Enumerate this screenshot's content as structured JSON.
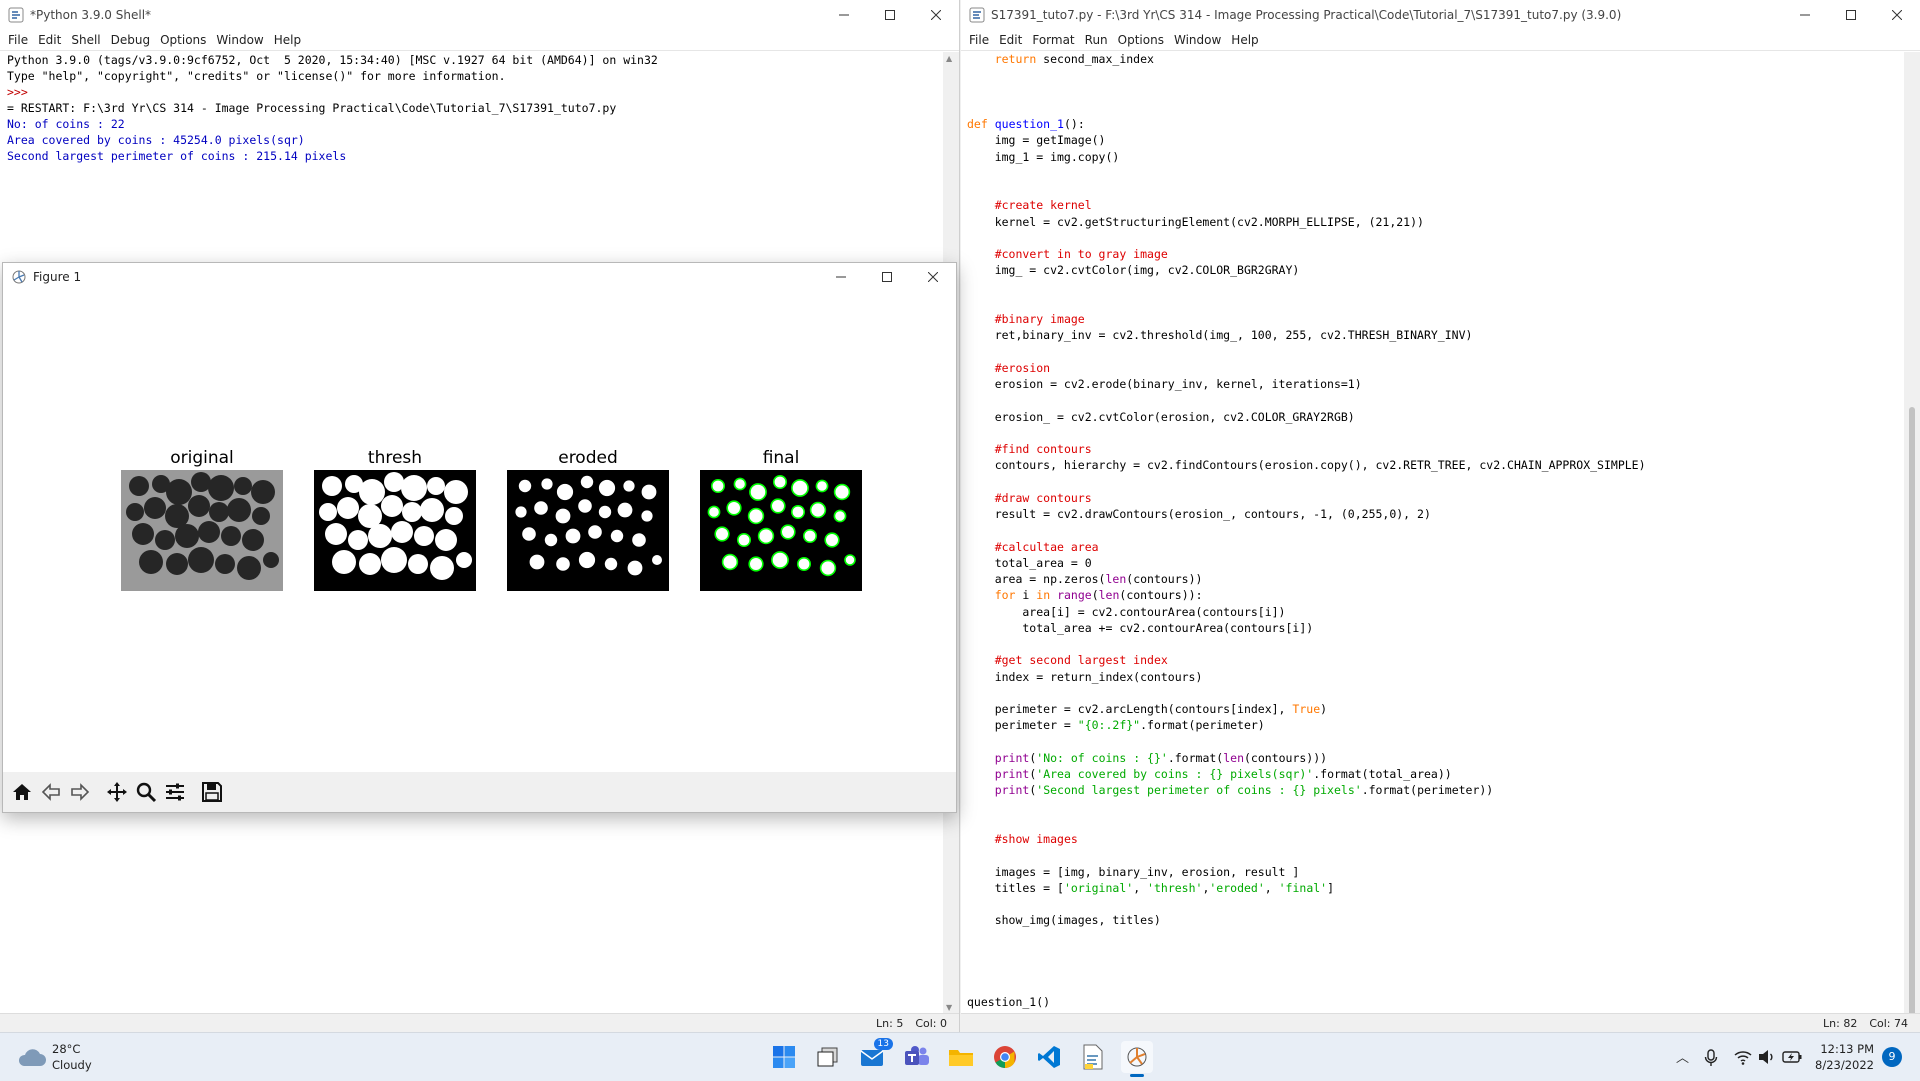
{
  "shell": {
    "title": "*Python 3.9.0 Shell*",
    "menu": [
      "File",
      "Edit",
      "Shell",
      "Debug",
      "Options",
      "Window",
      "Help"
    ],
    "lines": [
      {
        "text": "Python 3.9.0 (tags/v3.9.0:9cf6752, Oct  5 2020, 15:34:40) [MSC v.1927 64 bit (AMD64)] on win32",
        "style": "normal"
      },
      {
        "text": "Type \"help\", \"copyright\", \"credits\" or \"license()\" for more information.",
        "style": "normal"
      },
      {
        "text": ">>> ",
        "style": "prompt"
      },
      {
        "text": "= RESTART: F:\\3rd Yr\\CS 314 - Image Processing Practical\\Code\\Tutorial_7\\S17391_tuto7.py",
        "style": "normal"
      },
      {
        "text": "No: of coins : 22",
        "style": "out"
      },
      {
        "text": "Area covered by coins : 45254.0 pixels(sqr)",
        "style": "out"
      },
      {
        "text": "Second largest perimeter of coins : 215.14 pixels",
        "style": "out"
      }
    ],
    "status_ln": "Ln: 5",
    "status_col": "Col: 0"
  },
  "editor": {
    "title": "S17391_tuto7.py - F:\\3rd Yr\\CS 314 - Image Processing Practical\\Code\\Tutorial_7\\S17391_tuto7.py (3.9.0)",
    "menu": [
      "File",
      "Edit",
      "Format",
      "Run",
      "Options",
      "Window",
      "Help"
    ],
    "code": [
      "    return second_max_index",
      "",
      "",
      "",
      "def question_1():",
      "    img = getImage()",
      "    img_1 = img.copy()",
      "",
      "",
      "    #create kernel",
      "    kernel = cv2.getStructuringElement(cv2.MORPH_ELLIPSE, (21,21))",
      "",
      "    #convert in to gray image",
      "    img_ = cv2.cvtColor(img, cv2.COLOR_BGR2GRAY)",
      "",
      "",
      "    #binary image",
      "    ret,binary_inv = cv2.threshold(img_, 100, 255, cv2.THRESH_BINARY_INV)",
      "",
      "    #erosion",
      "    erosion = cv2.erode(binary_inv, kernel, iterations=1)",
      "",
      "    erosion_ = cv2.cvtColor(erosion, cv2.COLOR_GRAY2RGB)",
      "",
      "    #find contours",
      "    contours, hierarchy = cv2.findContours(erosion.copy(), cv2.RETR_TREE, cv2.CHAIN_APPROX_SIMPLE)",
      "",
      "    #draw contours",
      "    result = cv2.drawContours(erosion_, contours, -1, (0,255,0), 2)",
      "",
      "    #calcultae area",
      "    total_area = 0",
      "    area = np.zeros(len(contours))",
      "    for i in range(len(contours)):",
      "        area[i] = cv2.contourArea(contours[i])",
      "        total_area += cv2.contourArea(contours[i])",
      "",
      "    #get second largest index",
      "    index = return_index(contours)",
      "",
      "    perimeter = cv2.arcLength(contours[index], True)",
      "    perimeter = \"{0:.2f}\".format(perimeter)",
      "",
      "    print('No: of coins : {}'.format(len(contours)))",
      "    print('Area covered by coins : {} pixels(sqr)'.format(total_area))",
      "    print('Second largest perimeter of coins : {} pixels'.format(perimeter))",
      "",
      "",
      "    #show images",
      "",
      "    images = [img, binary_inv, erosion, result ]",
      "    titles = ['original', 'thresh','eroded', 'final']",
      "",
      "    show_img(images, titles)",
      "",
      "",
      "",
      "",
      "question_1()"
    ],
    "status_ln": "Ln: 82",
    "status_col": "Col: 74"
  },
  "figure": {
    "title": "Figure 1",
    "subplots": [
      "original",
      "thresh",
      "eroded",
      "final"
    ],
    "toolbar_icons": [
      "home-icon",
      "back-icon",
      "forward-icon",
      "pan-icon",
      "zoom-icon",
      "configure-icon",
      "save-icon"
    ]
  },
  "taskbar": {
    "weather_temp": "28°C",
    "weather_desc": "Cloudy",
    "mail_badge": "13",
    "time": "12:13 PM",
    "date": "8/23/2022",
    "notif_count": "9"
  },
  "colors": {
    "keyword": "#ff7700",
    "string": "#00aa00",
    "comment": "#dd0000",
    "builtin": "#900090",
    "definition": "#0000ff",
    "output": "#0000c0",
    "contour_green": "#00ff00"
  }
}
